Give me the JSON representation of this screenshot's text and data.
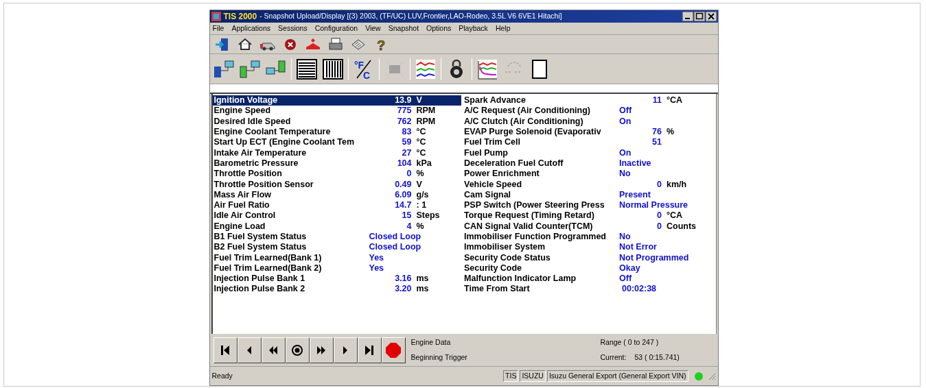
{
  "window": {
    "app_name": "TIS 2000",
    "title": "- Snapshot Upload/Display [(3) 2003, (TF/UC) LUV,Frontier,LAO-Rodeo, 3.5L V6 6VE1 Hitachi]"
  },
  "toolbar_glyphs": {
    "help": "?",
    "fahrenheit": "°F",
    "celsius": "C"
  },
  "menu": [
    "File",
    "Applications",
    "Sessions",
    "Configuration",
    "View",
    "Snapshot",
    "Options",
    "Playback",
    "Help"
  ],
  "data_columns": [
    {
      "rows": [
        {
          "name": "Ignition Voltage",
          "value": "13.9",
          "unit": "V",
          "kind": "number",
          "selected": true
        },
        {
          "name": "Engine Speed",
          "value": "775",
          "unit": "RPM",
          "kind": "number",
          "selected": false
        },
        {
          "name": "Desired Idle Speed",
          "value": "762",
          "unit": "RPM",
          "kind": "number",
          "selected": false
        },
        {
          "name": "Engine Coolant Temperature",
          "value": "83",
          "unit": "°C",
          "kind": "number",
          "selected": false
        },
        {
          "name": "Start Up ECT (Engine Coolant Tem",
          "value": "59",
          "unit": "°C",
          "kind": "number",
          "selected": false
        },
        {
          "name": "Intake Air Temperature",
          "value": "27",
          "unit": "°C",
          "kind": "number",
          "selected": false
        },
        {
          "name": "Barometric Pressure",
          "value": "104",
          "unit": "kPa",
          "kind": "number",
          "selected": false
        },
        {
          "name": "Throttle Position",
          "value": "0",
          "unit": "%",
          "kind": "number",
          "selected": false
        },
        {
          "name": "Throttle Position Sensor",
          "value": "0.49",
          "unit": "V",
          "kind": "number",
          "selected": false
        },
        {
          "name": "Mass Air Flow",
          "value": "6.09",
          "unit": "g/s",
          "kind": "number",
          "selected": false
        },
        {
          "name": "Air Fuel Ratio",
          "value": "14.7",
          "unit": ": 1",
          "kind": "number",
          "selected": false
        },
        {
          "name": "Idle Air Control",
          "value": "15",
          "unit": "Steps",
          "kind": "number",
          "selected": false
        },
        {
          "name": "Engine Load",
          "value": "4",
          "unit": "%",
          "kind": "number",
          "selected": false
        },
        {
          "name": "B1 Fuel System Status",
          "value": "Closed Loop",
          "kind": "text",
          "selected": false
        },
        {
          "name": "B2 Fuel System Status",
          "value": "Closed Loop",
          "kind": "text",
          "selected": false
        },
        {
          "name": "Fuel Trim Learned(Bank 1)",
          "value": "Yes",
          "kind": "text",
          "selected": false
        },
        {
          "name": "Fuel Trim Learned(Bank 2)",
          "value": "Yes",
          "kind": "text",
          "selected": false
        },
        {
          "name": "Injection Pulse Bank 1",
          "value": "3.16",
          "unit": "ms",
          "kind": "number",
          "selected": false
        },
        {
          "name": "Injection Pulse Bank 2",
          "value": "3.20",
          "unit": "ms",
          "kind": "number",
          "selected": false
        }
      ]
    },
    {
      "rows": [
        {
          "name": "Spark Advance",
          "value": "11",
          "unit": "°CA",
          "kind": "number",
          "selected": false
        },
        {
          "name": "A/C Request (Air Conditioning)",
          "value": "Off",
          "kind": "text",
          "selected": false
        },
        {
          "name": "A/C Clutch (Air Conditioning)",
          "value": "On",
          "kind": "text",
          "selected": false
        },
        {
          "name": "EVAP Purge Solenoid (Evaporativ",
          "value": "76",
          "unit": "%",
          "kind": "number",
          "selected": false
        },
        {
          "name": "Fuel Trim Cell",
          "value": "51",
          "kind": "number",
          "selected": false
        },
        {
          "name": "Fuel Pump",
          "value": "On",
          "kind": "text",
          "selected": false
        },
        {
          "name": "Deceleration Fuel Cutoff",
          "value": "Inactive",
          "kind": "text",
          "selected": false
        },
        {
          "name": "Power Enrichment",
          "value": "No",
          "kind": "text",
          "selected": false
        },
        {
          "name": "Vehicle Speed",
          "value": "0",
          "unit": "km/h",
          "kind": "number",
          "selected": false
        },
        {
          "name": "Cam Signal",
          "value": "Present",
          "kind": "text",
          "selected": false
        },
        {
          "name": "PSP Switch (Power Steering Press",
          "value": "Normal Pressure",
          "kind": "text",
          "selected": false
        },
        {
          "name": "Torque Request (Timing Retard)",
          "value": "0",
          "unit": "°CA",
          "kind": "number",
          "selected": false
        },
        {
          "name": "CAN Signal Valid Counter(TCM)",
          "value": "0",
          "unit": "Counts",
          "kind": "number",
          "selected": false
        },
        {
          "name": "Immobiliser Function Programmed",
          "value": "No",
          "kind": "text",
          "selected": false
        },
        {
          "name": "Immobiliser System",
          "value": "Not Error",
          "kind": "text",
          "selected": false
        },
        {
          "name": "Security Code Status",
          "value": "Not Programmed",
          "kind": "text",
          "selected": false
        },
        {
          "name": "Security Code",
          "value": "Okay",
          "kind": "text",
          "selected": false
        },
        {
          "name": "Malfunction Indicator Lamp",
          "value": "Off",
          "kind": "text",
          "selected": false
        },
        {
          "name": "Time From Start",
          "value": "00:02:38",
          "kind": "time",
          "selected": false
        }
      ]
    }
  ],
  "playback": {
    "data_label": "Engine Data",
    "trigger_label": "Beginning Trigger",
    "range": "Range ( 0 to 247 )",
    "current_label": "Current:",
    "current_value": "53 ( 0:15.741)"
  },
  "status_bar": {
    "message": "Ready",
    "panes": [
      "TIS",
      "ISUZU",
      "Isuzu General Export (General Export VIN)"
    ]
  }
}
